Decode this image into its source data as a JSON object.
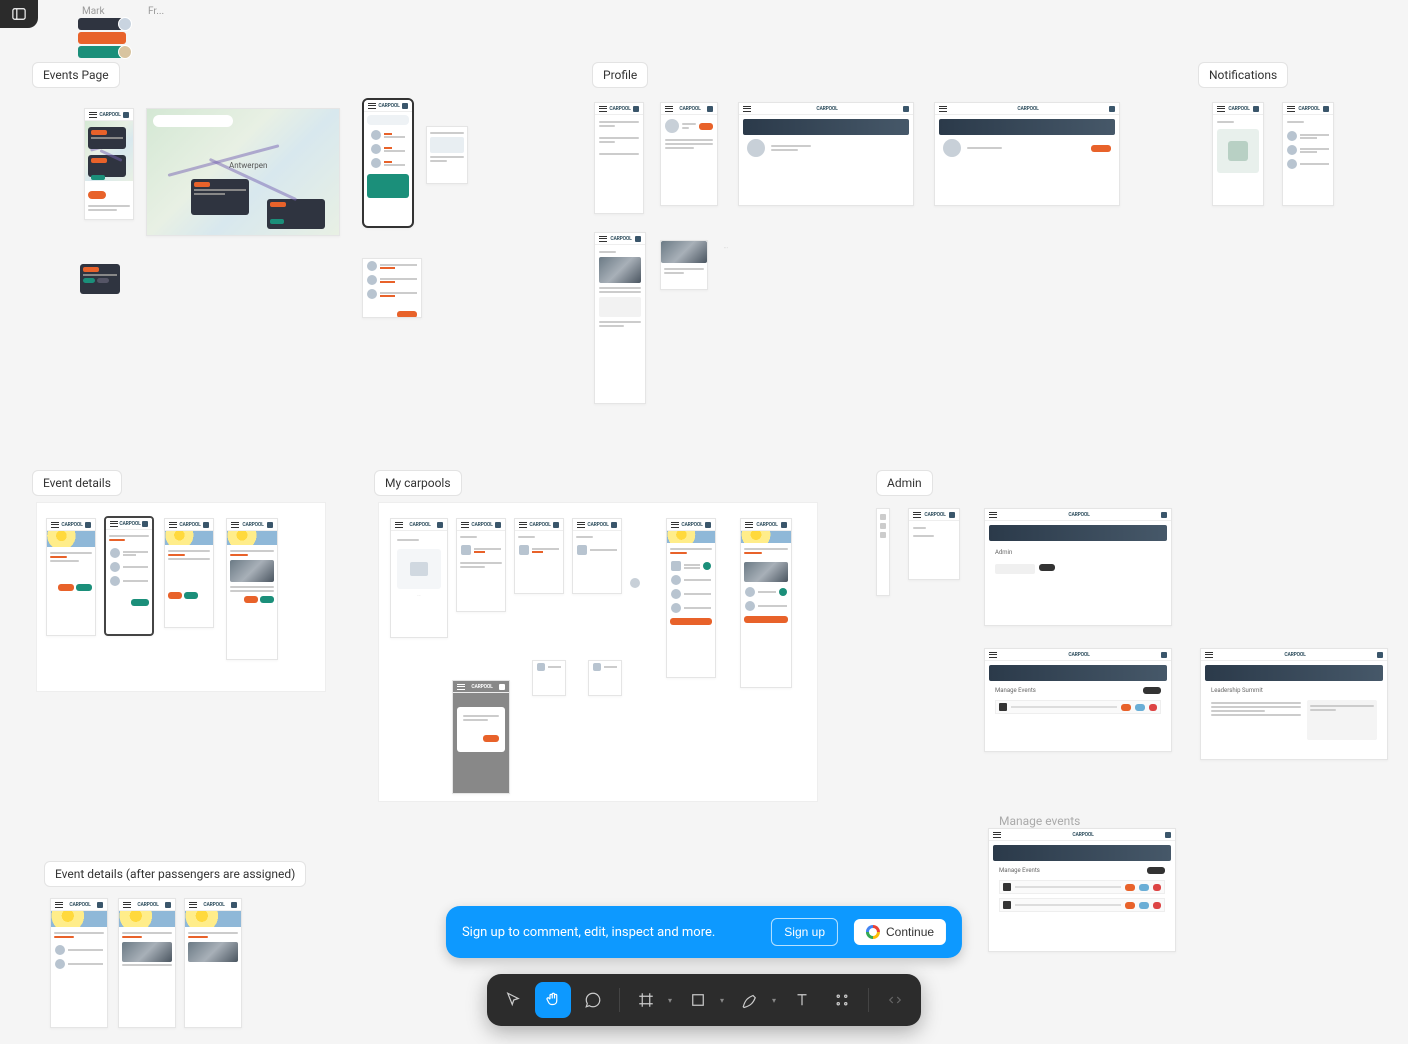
{
  "corner_labels": {
    "mark": "Mark",
    "fr": "Fr..."
  },
  "sections": {
    "events_page": "Events Page",
    "profile": "Profile",
    "notifications": "Notifications",
    "event_details": "Event details",
    "my_carpools": "My carpools",
    "admin": "Admin",
    "manage_events": "Manage events",
    "event_details_after": "Event details (after passengers are assigned)"
  },
  "app_brand": "CARPOOL",
  "map_city": "Antwerpen",
  "admin_labels": {
    "admin": "Admin",
    "manage_events": "Manage Events",
    "leadership": "Leadership Summit"
  },
  "banner": {
    "message": "Sign up to comment, edit, inspect and more.",
    "signup": "Sign up",
    "continue": "Continue"
  },
  "tools": {
    "move": "Move",
    "hand": "Hand",
    "comment": "Comment",
    "frame": "Frame",
    "shape": "Shape",
    "pen": "Pen",
    "text": "Text",
    "actions": "Actions",
    "dev": "Dev mode"
  }
}
